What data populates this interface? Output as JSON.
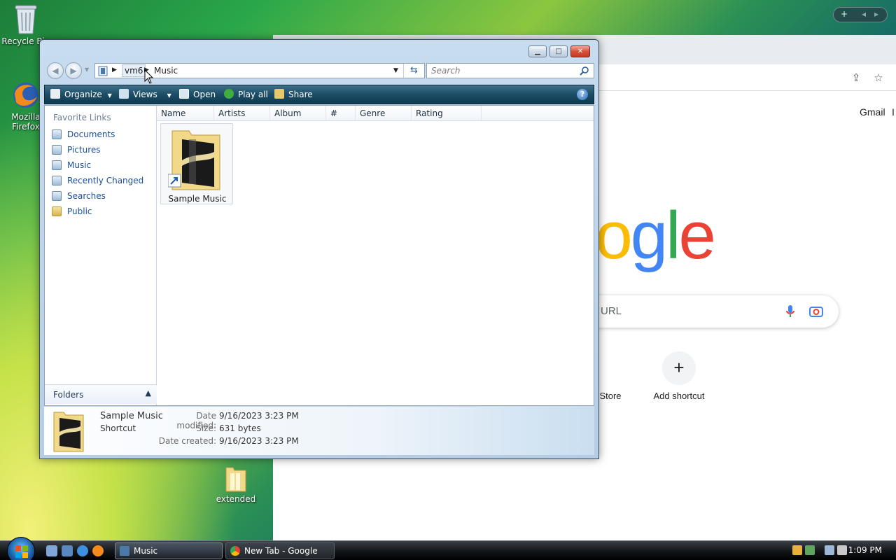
{
  "desktop": {
    "icons": [
      {
        "label": "Recycle Bin"
      },
      {
        "label": "Mozilla Firefox"
      },
      {
        "label": "extended"
      }
    ]
  },
  "chrome": {
    "header_links": [
      "Gmail",
      "I"
    ],
    "logo_text": "oogle",
    "search_placeholder": "URL",
    "shortcuts": [
      {
        "label": "Store"
      },
      {
        "label": "Add shortcut",
        "glyph": "+"
      }
    ],
    "taskbar_title": "New Tab - Google C..."
  },
  "explorer": {
    "title": "Music",
    "breadcrumbs": [
      "vm6",
      "Music"
    ],
    "search_placeholder": "Search",
    "commands": [
      {
        "label": "Organize",
        "dropdown": true
      },
      {
        "label": "Views",
        "dropdown": true
      },
      {
        "label": "Open"
      },
      {
        "label": "Play all"
      },
      {
        "label": "Share"
      }
    ],
    "favorites_header": "Favorite Links",
    "favorites": [
      {
        "label": "Documents"
      },
      {
        "label": "Pictures"
      },
      {
        "label": "Music"
      },
      {
        "label": "Recently Changed"
      },
      {
        "label": "Searches"
      },
      {
        "label": "Public"
      }
    ],
    "folders_label": "Folders",
    "columns": [
      "Name",
      "Artists",
      "Album",
      "#",
      "Genre",
      "Rating"
    ],
    "items": [
      {
        "label": "Sample Music"
      }
    ],
    "details": {
      "name": "Sample Music",
      "type": "Shortcut",
      "date_modified_label": "Date modified:",
      "date_modified": "9/16/2023 3:23 PM",
      "size_label": "Size:",
      "size": "631 bytes",
      "date_created_label": "Date created:",
      "date_created": "9/16/2023 3:23 PM"
    }
  },
  "taskbar": {
    "buttons": [
      {
        "label": "Music",
        "active": true
      },
      {
        "label": "New Tab - Google C...",
        "active": false
      }
    ],
    "clock": "1:09 PM"
  },
  "colors": {
    "accent_blue": "#1a4f9c",
    "cmdbar": "#1d4d66",
    "google_blue": "#4285F4",
    "google_red": "#EA4335",
    "google_yellow": "#FBBC05",
    "google_green": "#34A853"
  }
}
